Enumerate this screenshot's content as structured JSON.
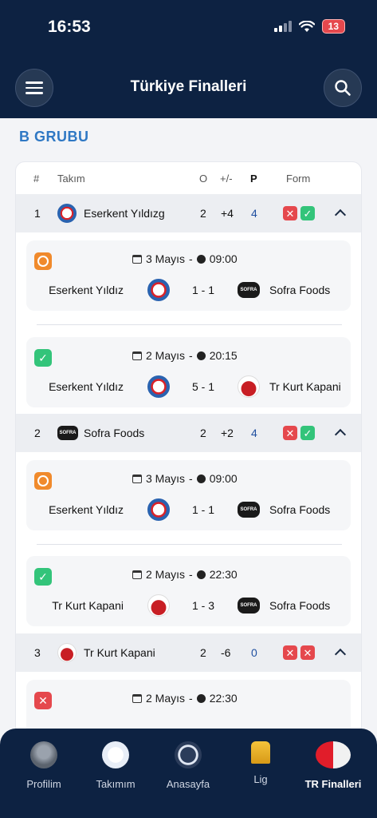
{
  "status_bar": {
    "time": "16:53",
    "battery": "13"
  },
  "header": {
    "title": "Türkiye Finalleri"
  },
  "group": {
    "title": "B GRUBU"
  },
  "table_header": {
    "rank": "#",
    "team": "Takım",
    "played": "O",
    "diff": "+/-",
    "points": "P",
    "form": "Form"
  },
  "teams": [
    {
      "rank": "1",
      "name": "Eserkent Yıldızg",
      "played": "2",
      "diff": "+4",
      "points": "4",
      "form": [
        "loss",
        "win"
      ],
      "matches": [
        {
          "status": "live",
          "date": "3 Mayıs",
          "sep": "-",
          "time": "09:00",
          "home": "Eserkent Yıldız",
          "score": "1 - 1",
          "away": "Sofra Foods"
        },
        {
          "status": "done",
          "date": "2 Mayıs",
          "sep": "-",
          "time": "20:15",
          "home": "Eserkent Yıldız",
          "score": "5 - 1",
          "away": "Tr Kurt Kapani"
        }
      ]
    },
    {
      "rank": "2",
      "name": "Sofra Foods",
      "played": "2",
      "diff": "+2",
      "points": "4",
      "form": [
        "loss",
        "win"
      ],
      "matches": [
        {
          "status": "live",
          "date": "3 Mayıs",
          "sep": "-",
          "time": "09:00",
          "home": "Eserkent Yıldız",
          "score": "1 - 1",
          "away": "Sofra Foods"
        },
        {
          "status": "done",
          "date": "2 Mayıs",
          "sep": "-",
          "time": "22:30",
          "home": "Tr Kurt Kapani",
          "score": "1 - 3",
          "away": "Sofra Foods"
        }
      ]
    },
    {
      "rank": "3",
      "name": "Tr Kurt Kapani",
      "played": "2",
      "diff": "-6",
      "points": "0",
      "form": [
        "loss",
        "loss"
      ],
      "matches": [
        {
          "status": "lost",
          "date": "2 Mayıs",
          "sep": "-",
          "time": "22:30"
        }
      ]
    }
  ],
  "sofra_logo_text": "SOFRA",
  "tabbar": [
    {
      "label": "Profilim",
      "icon": "profile-icon"
    },
    {
      "label": "Takımım",
      "icon": "team-badge-icon"
    },
    {
      "label": "Anasayfa",
      "icon": "league-logo-icon"
    },
    {
      "label": "Lig",
      "icon": "trophy-icon"
    },
    {
      "label": "TR Finalleri",
      "icon": "turkey-football-icon",
      "active": true
    }
  ]
}
